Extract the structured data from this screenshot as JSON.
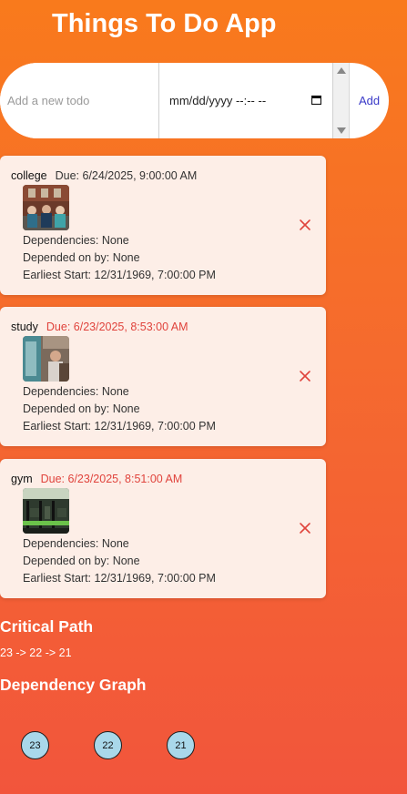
{
  "app": {
    "title": "Things To Do App"
  },
  "add_form": {
    "todo_placeholder": "Add a new todo",
    "date_placeholder": "mm/dd/yyyy  --:-- --",
    "add_label": "Add"
  },
  "todos": [
    {
      "title": "college",
      "due": "Due: 6/24/2025, 9:00:00 AM",
      "overdue": false,
      "dependencies": "Dependencies: None",
      "depended_on_by": "Depended on by: None",
      "earliest_start": "Earliest Start: 12/31/1969, 7:00:00 PM"
    },
    {
      "title": "study",
      "due": "Due: 6/23/2025, 8:53:00 AM",
      "overdue": true,
      "dependencies": "Dependencies: None",
      "depended_on_by": "Depended on by: None",
      "earliest_start": "Earliest Start: 12/31/1969, 7:00:00 PM"
    },
    {
      "title": "gym",
      "due": "Due: 6/23/2025, 8:51:00 AM",
      "overdue": true,
      "dependencies": "Dependencies: None",
      "depended_on_by": "Depended on by: None",
      "earliest_start": "Earliest Start: 12/31/1969, 7:00:00 PM"
    }
  ],
  "critical_path": {
    "title": "Critical Path",
    "value": "23 -> 22 -> 21"
  },
  "graph": {
    "title": "Dependency Graph",
    "nodes": [
      "23",
      "22",
      "21"
    ]
  },
  "colors": {
    "overdue": "#e0433c",
    "card": "#fdeee7",
    "node": "#a9d8ea",
    "delete": "#e0433c"
  }
}
